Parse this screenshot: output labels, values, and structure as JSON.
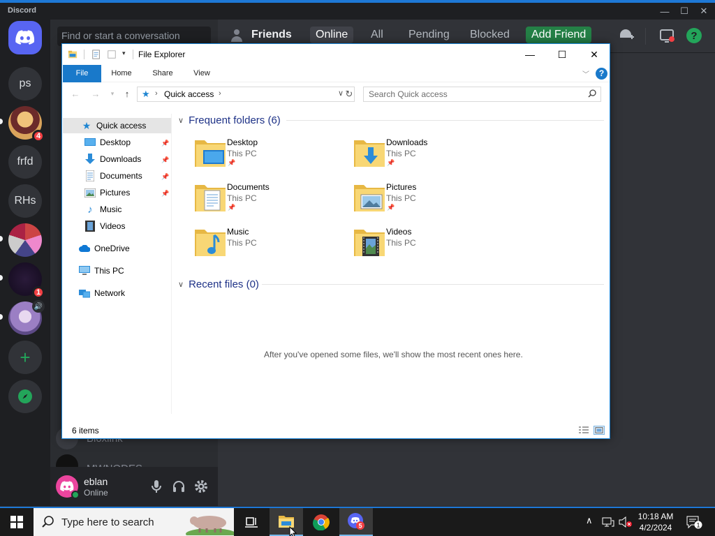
{
  "discord": {
    "app_title": "Discord",
    "guilds": [
      {
        "label": "ps"
      },
      {
        "label": "frfd"
      },
      {
        "label": "RHs"
      }
    ],
    "badges": {
      "avatar1": "4",
      "server_dark": "1"
    },
    "dm_search_placeholder": "Find or start a conversation",
    "dm_items": [
      "Bloxlink",
      "MWNODES"
    ],
    "friends_header": {
      "title": "Friends",
      "tabs": [
        "Online",
        "All",
        "Pending",
        "Blocked"
      ],
      "active_tab": "Online",
      "add_friend": "Add Friend"
    },
    "user": {
      "name": "eblan",
      "status": "Online"
    }
  },
  "file_explorer": {
    "window_title": "File Explorer",
    "ribbon_tabs": [
      "File",
      "Home",
      "Share",
      "View"
    ],
    "address": "Quick access",
    "search_placeholder": "Search Quick access",
    "nav_pane": {
      "quick_access": "Quick access",
      "pinned": [
        "Desktop",
        "Downloads",
        "Documents",
        "Pictures"
      ],
      "unpinned": [
        "Music",
        "Videos"
      ],
      "onedrive": "OneDrive",
      "this_pc": "This PC",
      "network": "Network"
    },
    "frequent_header": "Frequent folders (6)",
    "folders": [
      {
        "name": "Desktop",
        "location": "This PC",
        "pinned": true,
        "icon": "desktop-folder-icon"
      },
      {
        "name": "Downloads",
        "location": "This PC",
        "pinned": true,
        "icon": "downloads-folder-icon"
      },
      {
        "name": "Documents",
        "location": "This PC",
        "pinned": true,
        "icon": "documents-folder-icon"
      },
      {
        "name": "Pictures",
        "location": "This PC",
        "pinned": true,
        "icon": "pictures-folder-icon"
      },
      {
        "name": "Music",
        "location": "This PC",
        "pinned": false,
        "icon": "music-folder-icon"
      },
      {
        "name": "Videos",
        "location": "This PC",
        "pinned": false,
        "icon": "videos-folder-icon"
      }
    ],
    "recent_header": "Recent files (0)",
    "recent_empty": "After you've opened some files, we'll show the most recent ones here.",
    "status_count": "6 items"
  },
  "taskbar": {
    "search_placeholder": "Type here to search",
    "chrome_badge": "5",
    "clock_time": "10:18 AM",
    "clock_date": "4/2/2024",
    "notification_count": "1"
  },
  "colors": {
    "discord_bg": "#313338",
    "discord_blurple": "#5865f2",
    "accent_green": "#248046",
    "explorer_accent": "#1979ca",
    "folder_yellow": "#f8d775"
  }
}
